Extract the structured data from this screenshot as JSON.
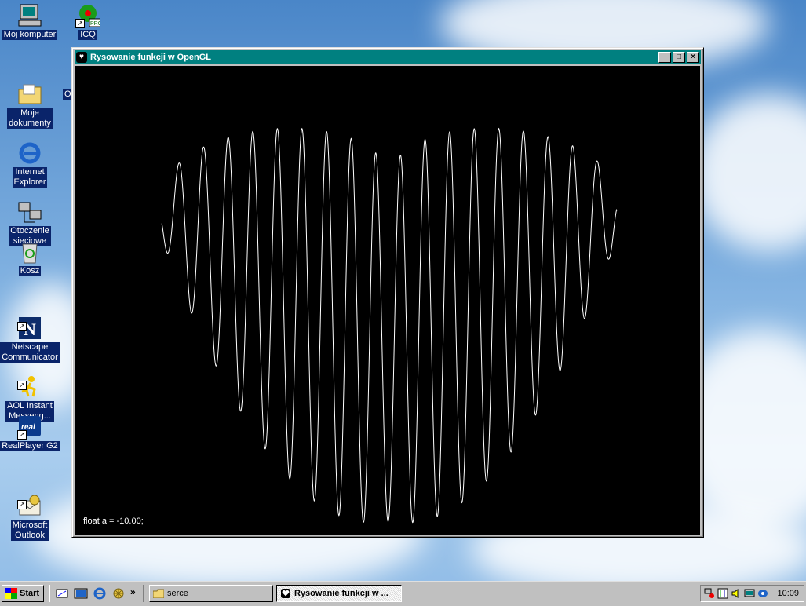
{
  "desktop": {
    "icons": [
      {
        "label": "Mój komputer",
        "name": "my-computer"
      },
      {
        "label": "ICQ",
        "name": "icq"
      },
      {
        "label": "Moje\ndokumenty",
        "name": "my-documents"
      },
      {
        "label": "Internet\nExplorer",
        "name": "internet-explorer"
      },
      {
        "label": "Otoczenie\nsieciowe",
        "name": "network-neighborhood"
      },
      {
        "label": "Kosz",
        "name": "recycle-bin"
      },
      {
        "label": "Netscape\nCommunicator",
        "name": "netscape-communicator"
      },
      {
        "label": "AOL Instant\nMesseng...",
        "name": "aol-instant-messenger"
      },
      {
        "label": "RealPlayer G2",
        "name": "realplayer"
      },
      {
        "label": "Microsoft\nOutlook",
        "name": "microsoft-outlook"
      }
    ],
    "partial_label": "O"
  },
  "window": {
    "title": "Rysowanie funkcji w OpenGL",
    "minimize_label": "_",
    "maximize_label": "□",
    "close_label": "×",
    "canvas_text": "float a = -10.00;",
    "line_color": "#ffffff",
    "background_color": "#000000"
  },
  "taskbar": {
    "start_label": "Start",
    "chevron_label": "»",
    "tasks": [
      {
        "label": "serce",
        "active": false
      },
      {
        "label": "Rysowanie funkcji w ...",
        "active": true
      }
    ],
    "clock": "10:09"
  },
  "colors": {
    "titlebar": "#008080",
    "desktop_sky": "#7fb0e0",
    "taskbar": "#c0c0c0"
  }
}
